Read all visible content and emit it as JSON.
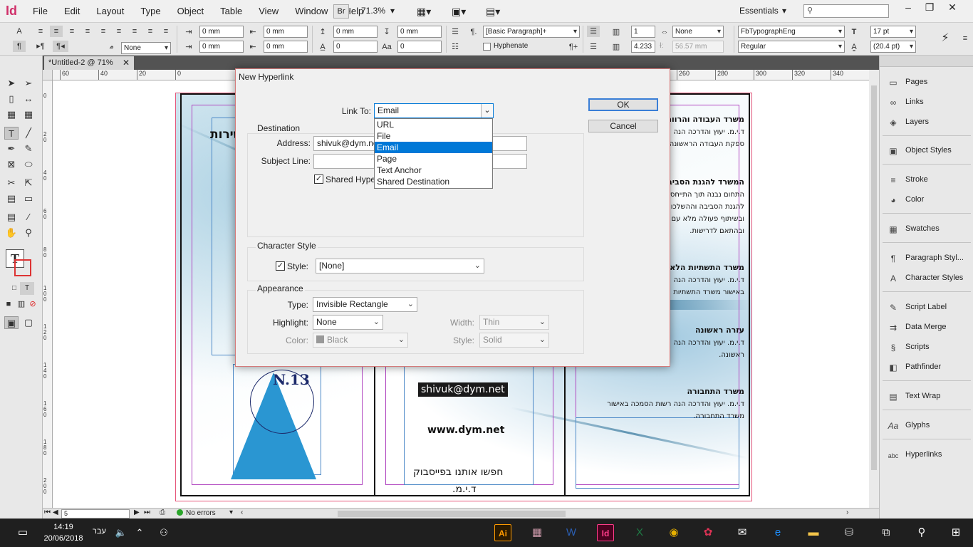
{
  "app": {
    "logo": "Id",
    "menus": [
      "File",
      "Edit",
      "Layout",
      "Type",
      "Object",
      "Table",
      "View",
      "Window",
      "Help"
    ],
    "bridge_label": "Br",
    "zoom": "71.3%",
    "workspace": "Essentials"
  },
  "control": {
    "indent_left": "0 mm",
    "indent_right": "0 mm",
    "first_line": "0 mm",
    "last_line": "0 mm",
    "space_before": "0 mm",
    "space_after": "0 mm",
    "drop_cap_lines": "0",
    "drop_cap_chars": "0",
    "bullet_none": "None",
    "paragraph_style": "[Basic Paragraph]+",
    "hyphenate_label": "Hyphenate",
    "columns": "1",
    "span": "None",
    "gutter": "4.233",
    "col_width": "56.57 mm",
    "font_family": "FbTypographEng",
    "font_style": "Regular",
    "font_size": "17 pt",
    "leading": "(20.4 pt)"
  },
  "document": {
    "tab_title": "*Untitled-2 @ 71%",
    "ruler_h": [
      "60",
      "40",
      "20",
      "0",
      "260",
      "280",
      "300",
      "320",
      "340"
    ],
    "ruler_v": [
      "0",
      "2 0",
      "4 0",
      "6 0",
      "8 0",
      "1 0 0",
      "1 2 0",
      "1 4 0",
      "1 6 0",
      "1 8 0",
      "2 0 0"
    ],
    "page_number": "5",
    "preflight": "No errors"
  },
  "spread": {
    "left_heading": "מוצרים ושירות",
    "stamp": "N.13",
    "email": "shivuk@dym.net",
    "website": "www.dym.net",
    "facebook": "חפשו אותנו בפייסבוק",
    "brand": "ד.י.מ.",
    "blocks": [
      {
        "title": "משרד העבודה והרווחה",
        "lines": [
          "ד.י.מ. יעוץ והדרכה הנה",
          "ספקת העבודה הראשונה"
        ]
      },
      {
        "title": "המשרד להגנת הסביבה",
        "lines": [
          "התחום נבנה תוך התייחסות",
          "להגנת הסביבה וההשלכות",
          "ובשיתוף פעולה מלא עם",
          "ובהתאם לדרישות."
        ]
      },
      {
        "title": "משרד התשתיות הלאומיות",
        "lines": [
          "ד.י.מ. יעוץ והדרכה הנה",
          "באישור משרד התשתיות"
        ]
      },
      {
        "title": "עזרה ראשונה",
        "lines": [
          "ד.י.מ. יעוץ והדרכה הנה",
          "ראשונה."
        ]
      },
      {
        "title": "משרד התחבורה",
        "lines": [
          "ד.י.מ. יעוץ והדרכה הנה רשות הסמכה באישור",
          "משרד התחבורה."
        ]
      }
    ]
  },
  "tools_panel": {
    "items": [
      "selection-tool",
      "direct-selection-tool",
      "page-tool",
      "gap-tool",
      "content-collector-tool",
      "content-placer-tool",
      "type-tool",
      "line-tool",
      "pen-tool",
      "pencil-tool",
      "rectangle-frame-tool",
      "ellipse-tool",
      "scissors-tool",
      "free-transform-tool",
      "gradient-swatch-tool",
      "gradient-feather-tool",
      "note-tool",
      "eyedropper-tool",
      "hand-tool",
      "zoom-tool"
    ]
  },
  "panels": {
    "items": [
      "Pages",
      "Links",
      "Layers",
      "Object Styles",
      "Stroke",
      "Color",
      "Swatches",
      "Paragraph Styl...",
      "Character Styles",
      "Script Label",
      "Data Merge",
      "Scripts",
      "Pathfinder",
      "Text Wrap",
      "Glyphs",
      "Hyperlinks"
    ]
  },
  "dialog": {
    "title": "New Hyperlink",
    "link_to_label": "Link To:",
    "link_to_value": "Email",
    "link_to_options": [
      "URL",
      "File",
      "Email",
      "Page",
      "Text Anchor",
      "Shared Destination"
    ],
    "link_to_selected_index": 2,
    "ok_label": "OK",
    "cancel_label": "Cancel",
    "destination": {
      "title": "Destination",
      "address_label": "Address:",
      "address_value": "shivuk@dym.ne",
      "subject_label": "Subject Line:",
      "subject_value": "",
      "shared_label": "Shared Hype",
      "shared_checked": true
    },
    "character_style": {
      "title": "Character Style",
      "style_label": "Style:",
      "style_value": "[None]",
      "checked": true
    },
    "appearance": {
      "title": "Appearance",
      "type_label": "Type:",
      "type_value": "Invisible Rectangle",
      "highlight_label": "Highlight:",
      "highlight_value": "None",
      "color_label": "Color:",
      "color_value": "Black",
      "width_label": "Width:",
      "width_value": "Thin",
      "style_label": "Style:",
      "style_value": "Solid"
    }
  },
  "taskbar": {
    "time": "14:19",
    "date": "20/06/2018",
    "language": "עבר",
    "apps": [
      "Ai",
      "Id"
    ]
  },
  "colors": {
    "indesign_pink": "#d0306a",
    "selection_blue": "#0078d7",
    "triangle_blue": "#2a96d2"
  }
}
